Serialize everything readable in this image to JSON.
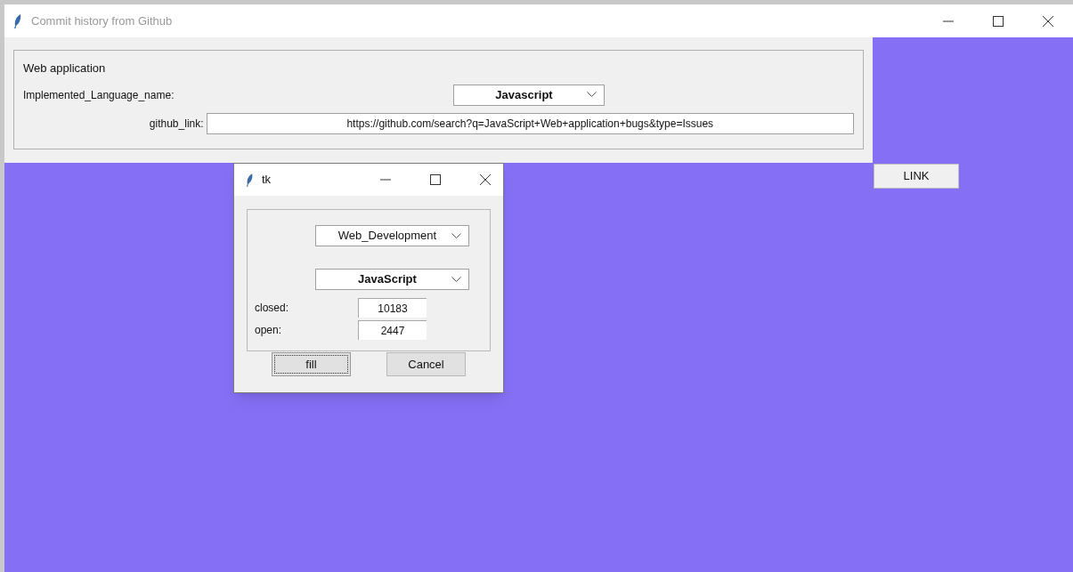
{
  "window": {
    "title": "Commit history from Github"
  },
  "group": {
    "title": "Web application",
    "language_label": "Implemented_Language_name:",
    "language_value": "Javascript",
    "link_label": "github_link:",
    "link_value": "https://github.com/search?q=JavaScript+Web+application+bugs&type=Issues"
  },
  "link_button": "LINK",
  "dialog": {
    "title": "tk",
    "category": "Web_Development",
    "language": "JavaScript",
    "counts": [
      {
        "label": "closed:",
        "value": "10183"
      },
      {
        "label": "open:",
        "value": "2447"
      }
    ],
    "buttons": [
      {
        "label": "fill",
        "focused": true
      },
      {
        "label": "Cancel",
        "focused": false
      }
    ]
  }
}
